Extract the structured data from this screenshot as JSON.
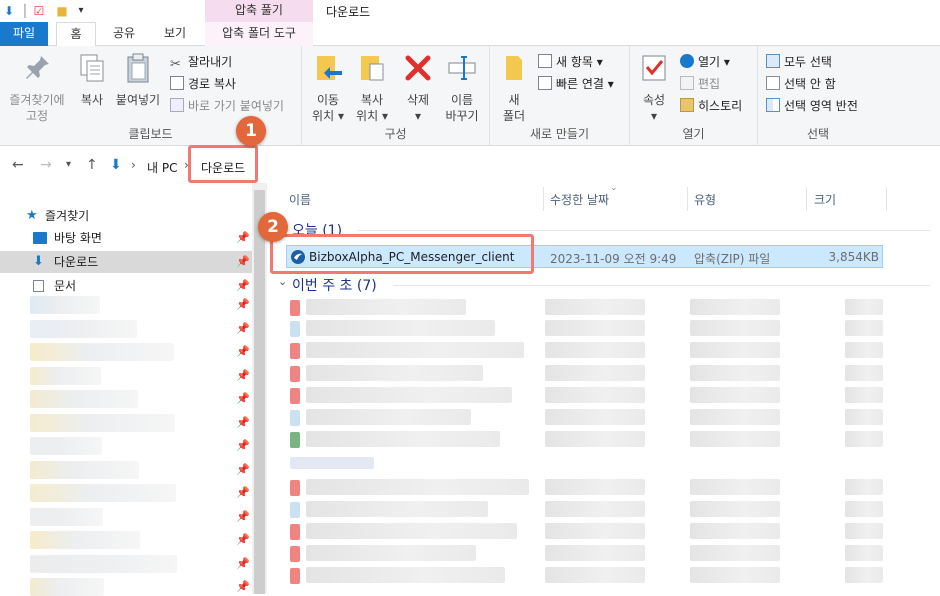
{
  "window": {
    "context_tab": "압축 풀기",
    "title": "다운로드"
  },
  "tabs": {
    "file": "파일",
    "home": "홈",
    "share": "공유",
    "view": "보기",
    "zip_tools": "압축 폴더 도구"
  },
  "ribbon": {
    "clipboard": {
      "label": "클립보드",
      "pin_quick_line1": "즐겨찾기에",
      "pin_quick_line2": "고정",
      "copy": "복사",
      "paste": "붙여넣기",
      "cut": "잘라내기",
      "copy_path": "경로 복사",
      "paste_shortcut": "바로 가기 붙여넣기"
    },
    "organize": {
      "label": "구성",
      "move_line1": "이동",
      "move_line2": "위치",
      "copyto_line1": "복사",
      "copyto_line2": "위치",
      "delete": "삭제",
      "rename_line1": "이름",
      "rename_line2": "바꾸기"
    },
    "new": {
      "label": "새로 만들기",
      "new_folder_line1": "새",
      "new_folder_line2": "폴더",
      "new_item": "새 항목",
      "easy_access": "빠른 연결"
    },
    "open": {
      "label": "열기",
      "properties": "속성",
      "open": "열기",
      "edit": "편집",
      "history": "히스토리"
    },
    "select": {
      "label": "선택",
      "select_all": "모두 선택",
      "select_none": "선택 안 함",
      "invert": "선택 영역 반전"
    }
  },
  "address": {
    "crumbs": [
      "내 PC",
      "다운로드"
    ]
  },
  "nav": {
    "quick_access": "즐겨찾기",
    "items": [
      {
        "label": "바탕 화면",
        "icon": "desktop-folder-icon"
      },
      {
        "label": "다운로드",
        "icon": "download-folder-icon"
      },
      {
        "label": "문서",
        "icon": "documents-icon"
      }
    ]
  },
  "columns": {
    "name": "이름",
    "modified": "수정한 날짜",
    "type": "유형",
    "size": "크기"
  },
  "groups": {
    "today": "오늘 (1)",
    "this_week": "이번 주 초 (7)"
  },
  "files": [
    {
      "name": "BizboxAlpha_PC_Messenger_client",
      "modified": "2023-11-09 오전 9:49",
      "type": "압축(ZIP) 파일",
      "size": "3,854KB",
      "icon": "zip-archive-icon"
    }
  ],
  "annotations": [
    "1",
    "2"
  ],
  "colors": {
    "file_tab": "#1979ca",
    "context_tab": "#f5dcee",
    "selection": "#cce8ff",
    "highlight": "#f07a72",
    "badge": "#e2673a"
  }
}
